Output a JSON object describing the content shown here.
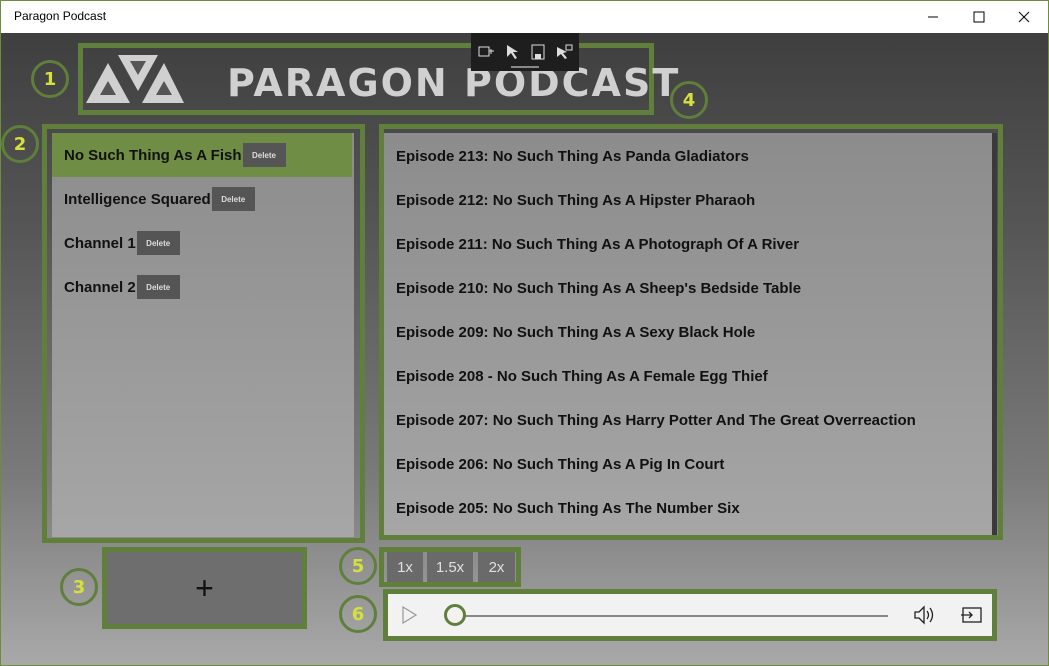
{
  "window": {
    "title": "Paragon Podcast"
  },
  "logo": {
    "text": "PARAGON PODCAST"
  },
  "badges": [
    "1",
    "2",
    "3",
    "4",
    "5",
    "6"
  ],
  "channels": [
    {
      "name": "No Such Thing As A Fish",
      "delete_label": "Delete"
    },
    {
      "name": "Intelligence Squared",
      "delete_label": "Delete"
    },
    {
      "name": "Channel 1",
      "delete_label": "Delete"
    },
    {
      "name": "Channel 2",
      "delete_label": "Delete"
    }
  ],
  "episodes": [
    "Episode 213: No Such Thing As Panda Gladiators",
    "Episode 212: No Such Thing As A Hipster Pharaoh",
    "Episode 211: No Such Thing As A Photograph Of A River",
    "Episode 210: No Such Thing As A Sheep's Bedside Table",
    "Episode 209: No Such Thing As A Sexy Black Hole",
    "Episode 208 - No Such Thing As A Female Egg Thief",
    "Episode 207: No Such Thing As Harry Potter And The Great Overreaction",
    "Episode 206: No Such Thing As A Pig In Court",
    "Episode 205: No Such Thing As The Number Six"
  ],
  "speeds": [
    "1x",
    "1.5x",
    "2x"
  ],
  "add_button": {
    "label": "+"
  },
  "player": {
    "progress": 0
  },
  "colors": {
    "accent": "#5f7f3a",
    "selected": "#6f8d44",
    "badge_text": "#d6e03a"
  }
}
